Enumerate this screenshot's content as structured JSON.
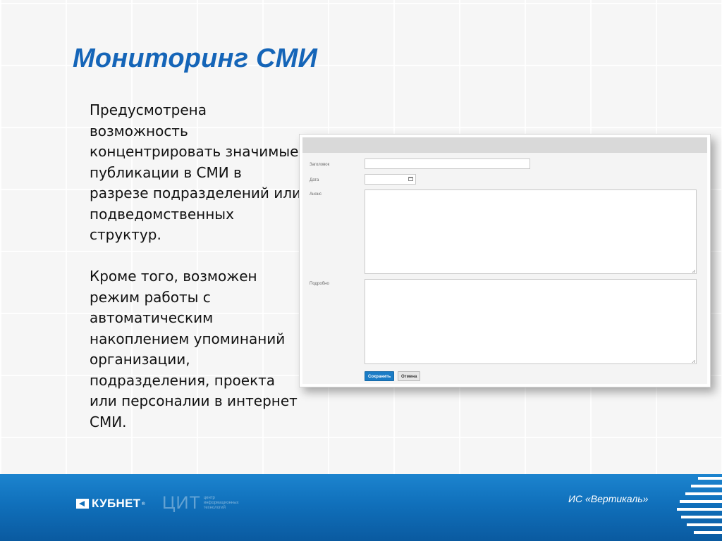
{
  "slide": {
    "title": "Мониторинг СМИ",
    "paragraphs": [
      "Предусмотрена возможность концентрировать значимые публикации в СМИ в разрезе подразделений или подведомственных структур.",
      "Кроме того, возможен режим работы с автоматическим накоплением упоминаний организации, подразделения, проекта или персоналии в интернет СМИ."
    ]
  },
  "form": {
    "fields": {
      "title_label": "Заголовок",
      "title_value": "",
      "date_label": "Дата",
      "date_value": "",
      "announce_label": "Анонс",
      "announce_value": "",
      "details_label": "Подробно",
      "details_value": ""
    },
    "buttons": {
      "save": "Сохранить",
      "cancel": "Отмена"
    },
    "icons": {
      "date_picker": "calendar-icon"
    }
  },
  "footer": {
    "logo_kubnet": "КУБНЕТ",
    "logo_kubnet_reg": "®",
    "logo_cit_mark": "ЦИТ",
    "logo_cit_text": "центр информационных технологий",
    "product": "ИС «Вертикаль»"
  },
  "colors": {
    "title": "#1565b8",
    "band": "#1070bb",
    "save_button": "#1a7cc6"
  }
}
